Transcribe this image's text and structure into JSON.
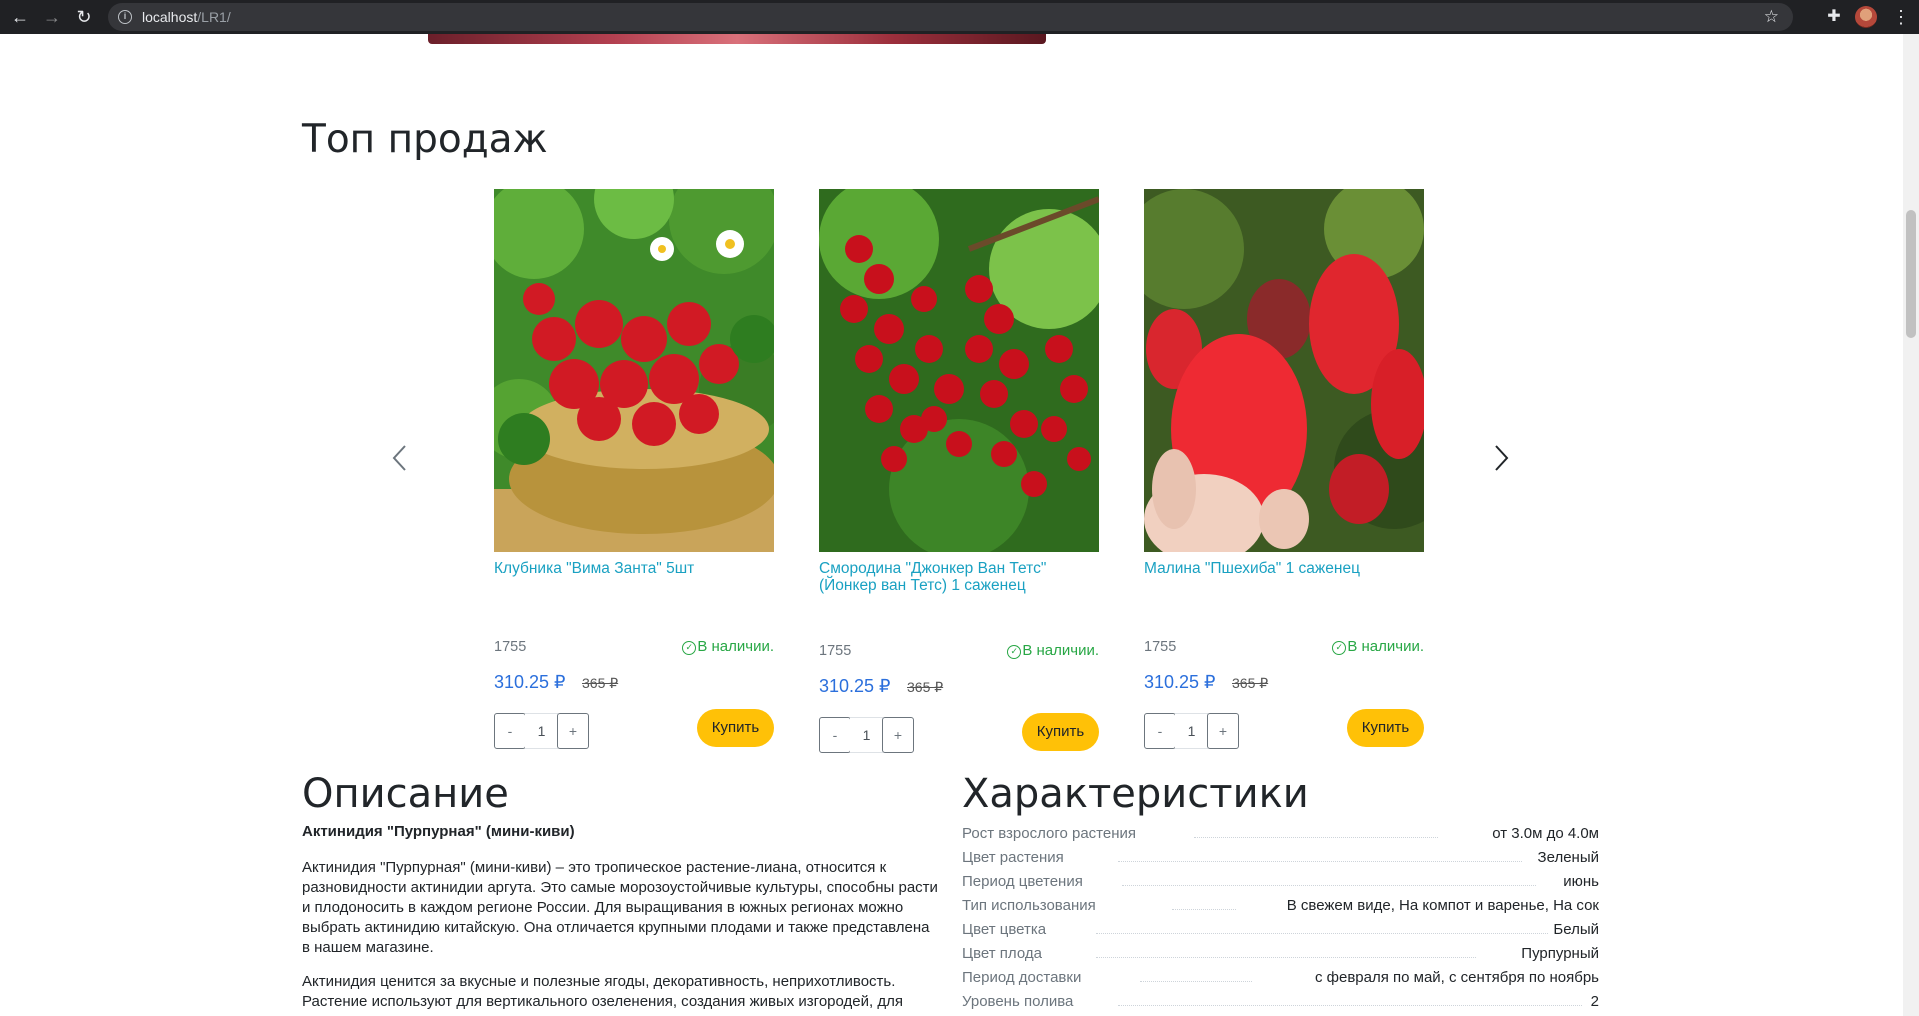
{
  "browser": {
    "url_host": "localhost",
    "url_path": "/LR1/"
  },
  "top_sales": {
    "title": "Топ продаж",
    "products": [
      {
        "name": "Клубника \"Вима Занта\" 5шт",
        "code": "1755",
        "stock": "В наличии.",
        "price": "310.25 ₽",
        "old_price": "365 ₽",
        "qty": "1",
        "minus": "-",
        "plus": "+",
        "buy": "Купить",
        "image": "strawberry"
      },
      {
        "name": "Смородина \"Джонкер Ван Тетс\" (Йонкер ван Тетс) 1 саженец",
        "code": "1755",
        "stock": "В наличии.",
        "price": "310.25 ₽",
        "old_price": "365 ₽",
        "qty": "1",
        "minus": "-",
        "plus": "+",
        "buy": "Купить",
        "image": "currant"
      },
      {
        "name": "Малина \"Пшехиба\" 1 саженец",
        "code": "1755",
        "stock": "В наличии.",
        "price": "310.25 ₽",
        "old_price": "365 ₽",
        "qty": "1",
        "minus": "-",
        "plus": "+",
        "buy": "Купить",
        "image": "raspberry"
      }
    ]
  },
  "description": {
    "title": "Описание",
    "lead": "Актинидия \"Пурпурная\" (мини-киви)",
    "paragraphs": [
      "Актинидия \"Пурпурная\" (мини-киви) – это тропическое растение-лиана, относится к разновидности актинидии аргута. Это самые морозоустойчивые культуры, способны расти и плодоносить в каждом регионе России. Для выращивания в южных регионах можно выбрать актинидию китайскую. Она отличается крупными плодами и также представлена в нашем магазине.",
      "Актинидия ценится за вкусные и полезные ягоды, декоративность, неприхотливость. Растение используют для вертикального озеленения, создания живых изгородей, для"
    ]
  },
  "specs": {
    "title": "Характеристики",
    "rows": [
      {
        "key": "Рост взрослого растения",
        "value": "от 3.0м до 4.0м"
      },
      {
        "key": "Цвет растения",
        "value": "Зеленый"
      },
      {
        "key": "Период цветения",
        "value": "июнь"
      },
      {
        "key": "Тип использования",
        "value": "В свежем виде, На компот и варенье, На сок"
      },
      {
        "key": "Цвет цветка",
        "value": "Белый"
      },
      {
        "key": "Цвет плода",
        "value": "Пурпурный"
      },
      {
        "key": "Период доставки",
        "value": "с февраля по май, с сентября по ноябрь"
      },
      {
        "key": "Уровень полива",
        "value": "2"
      }
    ]
  }
}
